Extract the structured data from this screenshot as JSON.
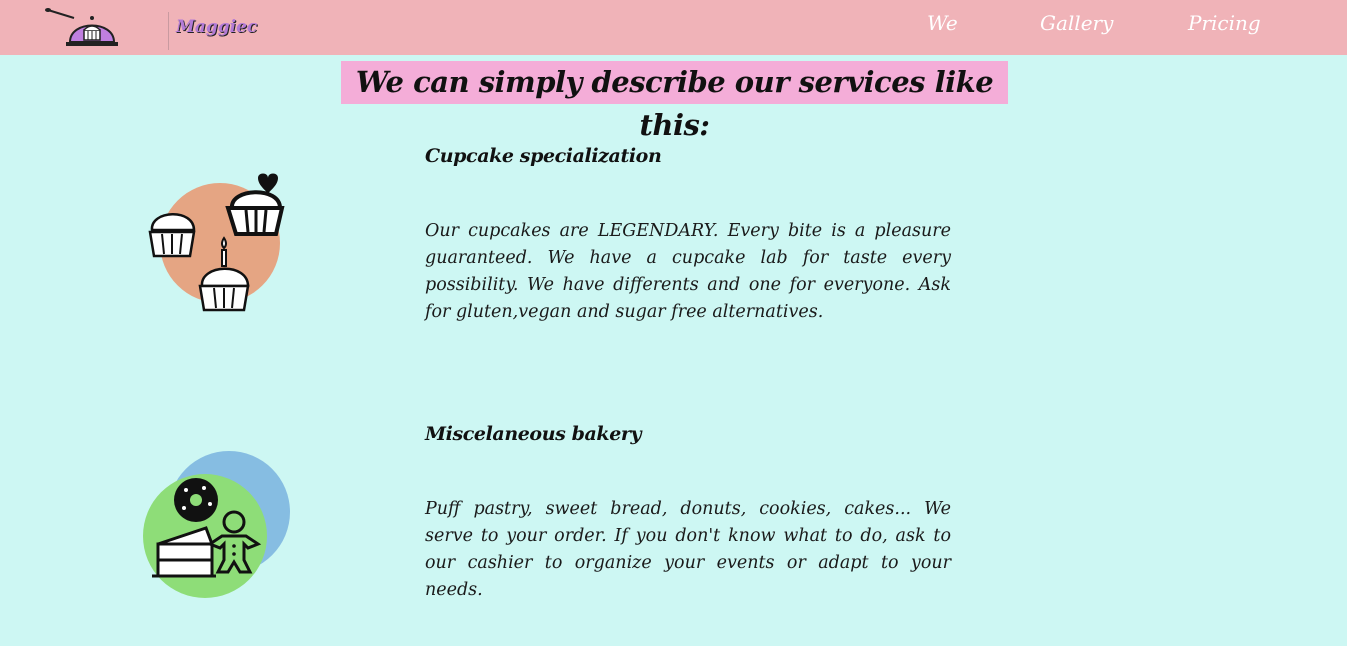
{
  "brand": {
    "name": "Maggiec",
    "logo_icon": "oven-icon"
  },
  "nav": {
    "items": [
      {
        "label": "We"
      },
      {
        "label": "Gallery"
      },
      {
        "label": "Pricing"
      }
    ]
  },
  "services": {
    "title": "We can simply describe our services like this:",
    "items": [
      {
        "title": "Cupcake specialization",
        "text": "Our cupcakes are LEGENDARY. Every bite is a pleasure guaranteed. We have a cupcake lab for taste every possibility. We have differents and one for everyone. Ask for gluten,vegan and sugar free alternatives.",
        "icon": "cupcakes-icon",
        "accent": "#e5a583"
      },
      {
        "title": "Miscelaneous bakery",
        "text": "Puff pastry, sweet bread, donuts, cookies, cakes... We serve to your order. If you don't know what to do, ask to our cashier to organize your events or adapt to your needs.",
        "icon": "bakery-icon",
        "accent": "#8edd78",
        "accent_secondary": "#86bde2"
      }
    ]
  },
  "colors": {
    "navbar": "#f0b3b8",
    "background": "#cdf7f3",
    "title_bg": "#f4add8"
  }
}
